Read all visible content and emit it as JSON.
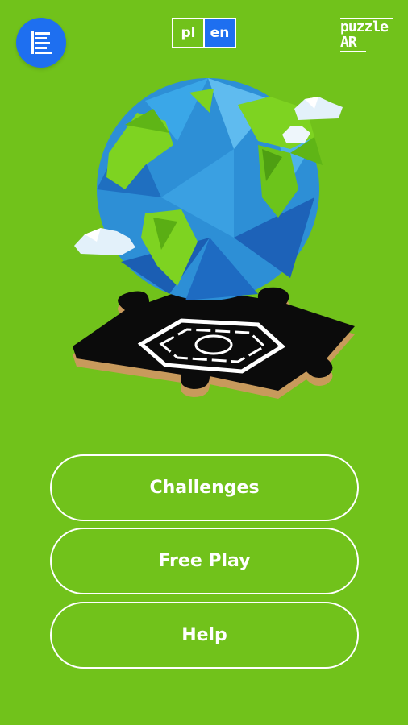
{
  "header": {
    "menu_icon": "list-menu-icon",
    "languages": [
      {
        "code": "pl",
        "label": "pl",
        "active": false
      },
      {
        "code": "en",
        "label": "en",
        "active": true
      }
    ],
    "logo_line1": "puzzle",
    "logo_line2": "AR"
  },
  "hero": {
    "image": "low-poly-globe-on-puzzle-piece",
    "marker_icon": "ar-marker-icon"
  },
  "menu": {
    "challenges_label": "Challenges",
    "free_play_label": "Free Play",
    "help_label": "Help"
  },
  "colors": {
    "background": "#71c21b",
    "accent_blue": "#1e6ff0",
    "ocean": "#2d8fd6",
    "land": "#7ed321"
  }
}
